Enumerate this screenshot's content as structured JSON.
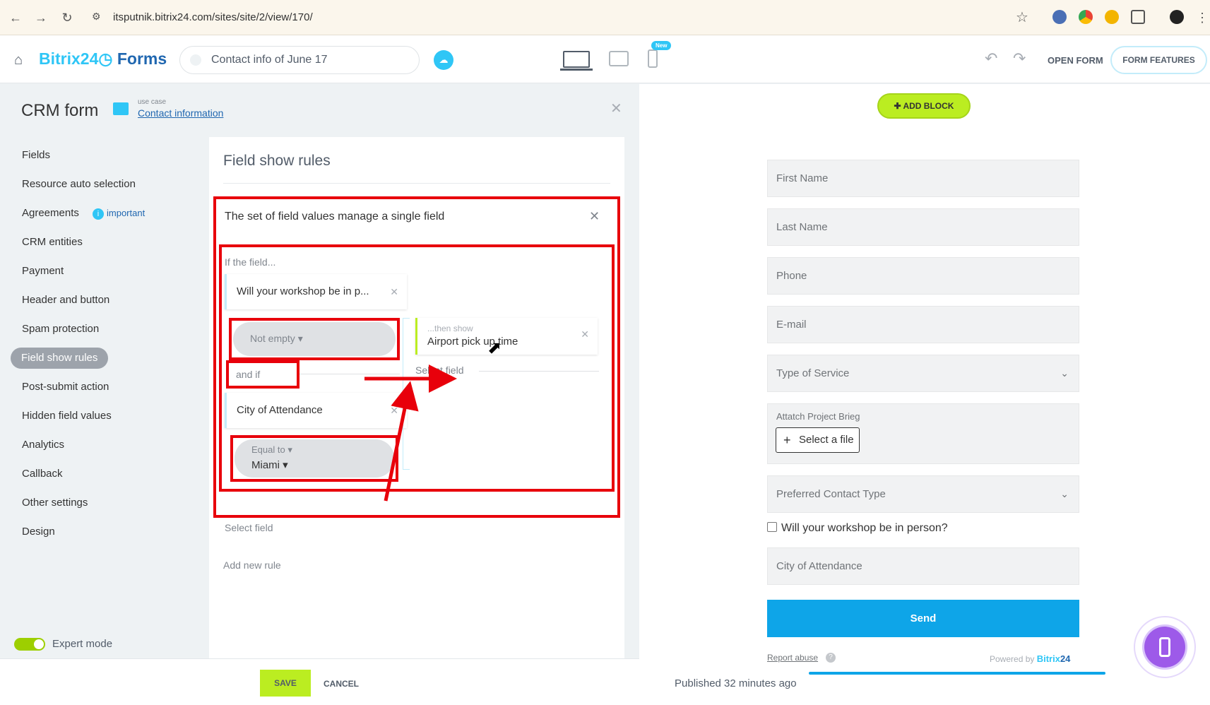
{
  "browser": {
    "url": "itsputnik.bitrix24.com/sites/site/2/view/170/"
  },
  "header": {
    "brand_main": "Bitrix24",
    "brand_suffix": "Forms",
    "form_name": "Contact info of June 17",
    "new_badge": "New",
    "open_form": "OPEN FORM",
    "form_features": "FORM FEATURES"
  },
  "panel": {
    "title": "CRM form",
    "use_case_label": "use case",
    "use_case_value": "Contact information",
    "menu": [
      {
        "label": "Fields"
      },
      {
        "label": "Resource auto selection"
      },
      {
        "label": "Agreements",
        "badge": "important"
      },
      {
        "label": "CRM entities"
      },
      {
        "label": "Payment"
      },
      {
        "label": "Header and button"
      },
      {
        "label": "Spam protection"
      },
      {
        "label": "Field show rules",
        "active": true
      },
      {
        "label": "Post-submit action"
      },
      {
        "label": "Hidden field values"
      },
      {
        "label": "Analytics"
      },
      {
        "label": "Callback"
      },
      {
        "label": "Other settings"
      },
      {
        "label": "Design"
      }
    ],
    "expert_mode": {
      "label": "Expert mode",
      "enabled": true
    },
    "save": "SAVE",
    "cancel": "CANCEL"
  },
  "rules": {
    "title": "Field show rules",
    "rule": {
      "description": "The set of field values manage a single field",
      "if_label": "If the field...",
      "condition1": {
        "field": "Will your workshop be in p...",
        "operator": "Not empty"
      },
      "and_if": "and if",
      "condition2": {
        "field": "City of Attendance",
        "operator": "Equal to",
        "value": "Miami"
      },
      "then_label": "...then show",
      "then_value": "Airport pick up time",
      "select_field_right": "Select field",
      "select_field_bottom": "Select field"
    },
    "add_new_rule": "Add new rule"
  },
  "preview": {
    "add_block": "ADD BLOCK",
    "fields": {
      "first_name": "First Name",
      "last_name": "Last Name",
      "phone": "Phone",
      "email": "E-mail",
      "type_of_service": "Type of Service",
      "attach_label": "Attatch Project Brieg",
      "select_file": "Select a file",
      "preferred_contact": "Preferred Contact Type",
      "workshop_checkbox": "Will your workshop be in person?",
      "city": "City of Attendance"
    },
    "send": "Send",
    "report_abuse": "Report abuse",
    "powered_by": "Powered by",
    "powered_brand_a": "Bitrix",
    "powered_brand_b": "24",
    "published": "Published 32 minutes ago"
  },
  "colors": {
    "accent_blue": "#2fc6f6",
    "brand_dark_blue": "#2067b0",
    "green": "#bbed21",
    "annotation_red": "#e8000b",
    "send_blue": "#0ea5e8",
    "phone_purple": "#9d5ae9"
  }
}
